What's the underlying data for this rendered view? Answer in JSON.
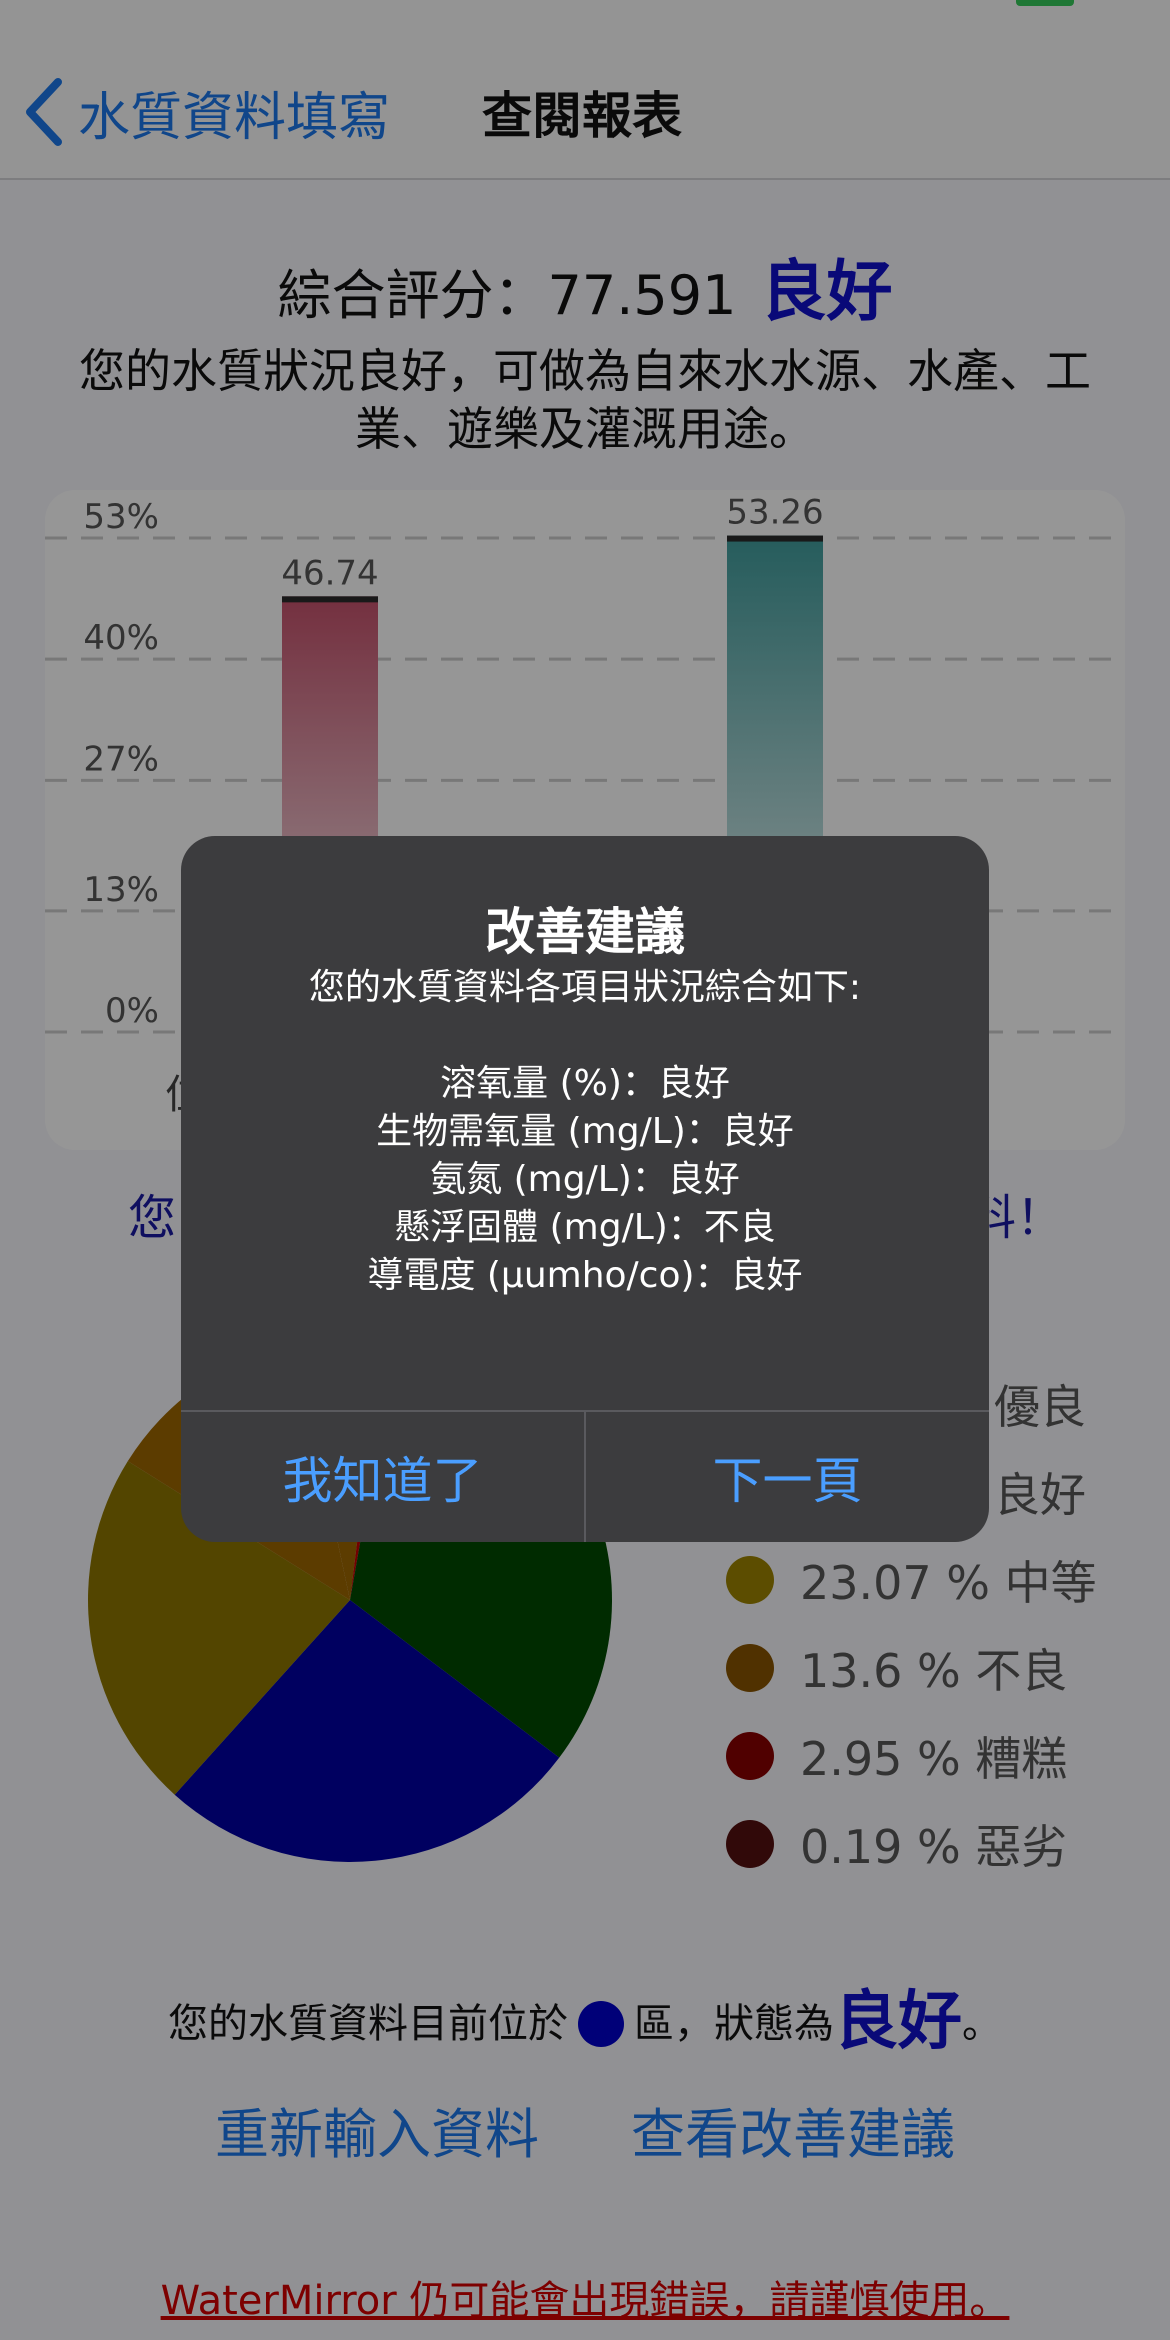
{
  "nav": {
    "back_label": "水質資料填寫",
    "title": "查閱報表"
  },
  "summary": {
    "score_label": "綜合評分：77.591",
    "grade": "良好",
    "description": "您的水質狀況良好，可做為自來水水源、水產、工業、遊樂及灌溉用途。"
  },
  "chart_data": {
    "type": "bar",
    "categories": [
      "",
      ""
    ],
    "values": [
      46.74,
      53.26
    ],
    "value_labels": [
      "46.74",
      "53.26"
    ],
    "y_ticks": [
      "53%",
      "40%",
      "27%",
      "13%",
      "0%"
    ],
    "y_tick_values": [
      53,
      40,
      27,
      13,
      0
    ],
    "ylim": [
      0,
      53
    ],
    "grid": true,
    "colors": [
      "#c2506a",
      "#3f9a9a"
    ]
  },
  "bar_axis_partial": "位",
  "warning_partial": {
    "left": "您",
    "right": "料！"
  },
  "pie_data": {
    "type": "pie",
    "slices": [
      {
        "percent": "",
        "label": "優良",
        "value": 0,
        "color": "#b4a000"
      },
      {
        "percent": "",
        "label": "良好",
        "value": 0,
        "color": "#006400"
      },
      {
        "percent": "23.07 %",
        "label": "中等",
        "value": 23.07,
        "color": "#ffd700"
      },
      {
        "percent": "13.6 %",
        "label": "不良",
        "value": 13.6,
        "color": "#e08a00"
      },
      {
        "percent": "2.95 %",
        "label": "糟糕",
        "value": 2.95,
        "color": "#dd0000"
      },
      {
        "percent": "0.19 %",
        "label": "惡劣",
        "value": 0.19,
        "color": "#8b1a1a"
      }
    ]
  },
  "position": {
    "prefix": "您的水質資料目前位於",
    "middle": "區，狀態為",
    "grade": "良好",
    "suffix": "。",
    "dot_color": "#0000c8"
  },
  "actions": {
    "reenter": "重新輸入資料",
    "view_suggestions": "查看改善建議"
  },
  "footer_warning": "WaterMirror 仍可能會出現錯誤，請謹慎使用。",
  "alert": {
    "title": "改善建議",
    "intro": "您的水質資料各項目狀況綜合如下:",
    "items": [
      "溶氧量 (%)：良好",
      "生物需氧量 (mg/L)：良好",
      "氨氮 (mg/L)：良好",
      "懸浮固體 (mg/L)：不良",
      "導電度 (µumho/co)：良好"
    ],
    "button_ok": "我知道了",
    "button_next": "下一頁"
  }
}
